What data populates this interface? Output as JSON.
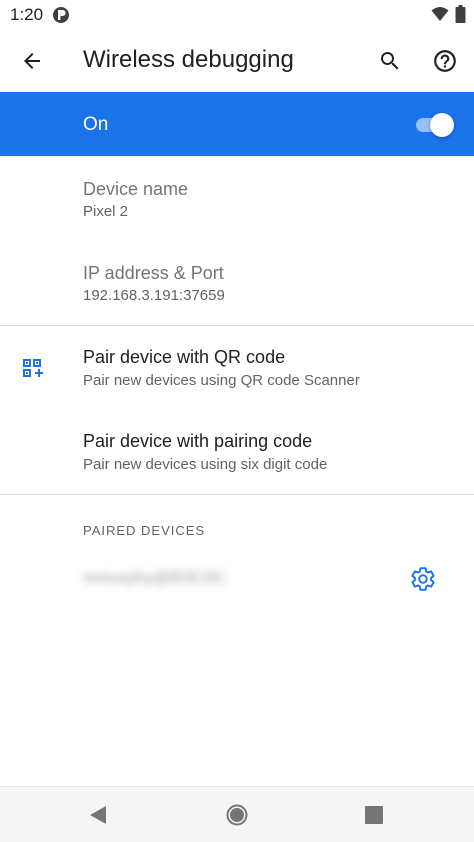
{
  "status_bar": {
    "time": "1:20",
    "icons": [
      "app-notification-icon",
      "wifi-icon",
      "battery-icon"
    ]
  },
  "app_bar": {
    "title": "Wireless debugging",
    "icons": [
      "back-arrow-icon",
      "search-icon",
      "help-icon"
    ]
  },
  "master_switch": {
    "label": "On",
    "checked": true
  },
  "device_info": {
    "device_name_title": "Device name",
    "device_name_value": "Pixel 2",
    "ip_title": "IP address & Port",
    "ip_value": "192.168.3.191:37659"
  },
  "pairing": {
    "qr_title": "Pair device with QR code",
    "qr_summary": "Pair new devices using QR code Scanner",
    "code_title": "Pair device with pairing code",
    "code_summary": "Pair new devices using six digit code"
  },
  "paired_devices": {
    "category": "PAIRED DEVICES",
    "items": [
      {
        "name": "mmurphy@B3C0C"
      }
    ]
  },
  "colors": {
    "accent": "#1a73e8",
    "text_primary": "#202124",
    "text_secondary": "#5f6368"
  }
}
